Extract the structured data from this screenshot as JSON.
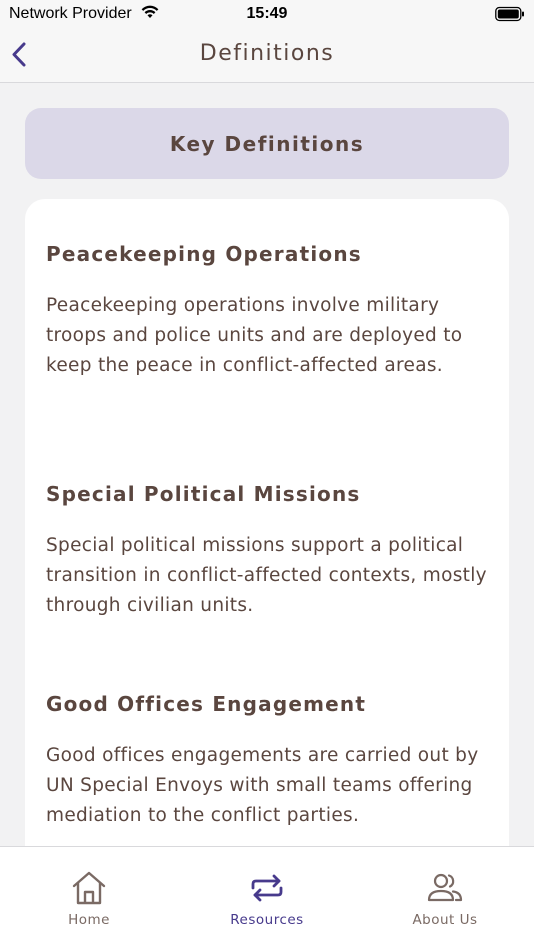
{
  "status_bar": {
    "carrier": "Network Provider",
    "time": "15:49"
  },
  "nav": {
    "title": "Definitions",
    "back_icon": "chevron-left-icon"
  },
  "section": {
    "header": "Key Definitions"
  },
  "definitions": [
    {
      "title": "Peacekeeping Operations",
      "body": "Peacekeeping operations involve military troops and police units and are deployed to keep the peace in conflict-affected areas."
    },
    {
      "title": "Special Political Missions",
      "body": "Special political missions support a political transition in conflict-affected contexts, mostly through civilian units."
    },
    {
      "title": "Good Offices Engagement",
      "body": "Good offices engagements are carried out by UN Special Envoys with small teams offering mediation to the conflict parties."
    }
  ],
  "tabs": [
    {
      "label": "Home",
      "icon": "home-icon",
      "active": false
    },
    {
      "label": "Resources",
      "icon": "exchange-icon",
      "active": true
    },
    {
      "label": "About Us",
      "icon": "users-icon",
      "active": false
    }
  ],
  "colors": {
    "accent": "#473a8c",
    "text": "#5a463f",
    "header_bg": "#dbd8e8",
    "page_bg": "#f2f2f3"
  }
}
